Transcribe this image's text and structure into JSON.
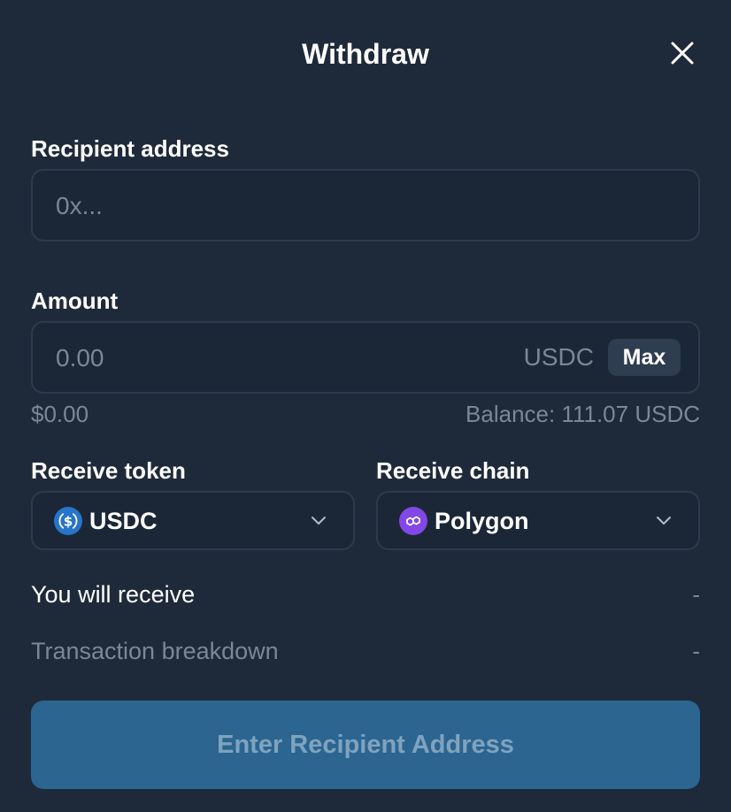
{
  "modal": {
    "title": "Withdraw"
  },
  "recipient": {
    "label": "Recipient address",
    "placeholder": "0x...",
    "value": ""
  },
  "amount": {
    "label": "Amount",
    "placeholder": "0.00",
    "value": "",
    "currency": "USDC",
    "max_label": "Max",
    "usd_value": "$0.00",
    "balance": "Balance: 111.07 USDC"
  },
  "receive_token": {
    "label": "Receive token",
    "selected": "USDC",
    "icon": "usdc-icon",
    "icon_color": "#2775ca"
  },
  "receive_chain": {
    "label": "Receive chain",
    "selected": "Polygon",
    "icon": "polygon-icon",
    "icon_color": "#8247e5"
  },
  "summary": {
    "receive_label": "You will receive",
    "receive_value": "-",
    "breakdown_label": "Transaction breakdown",
    "breakdown_value": "-"
  },
  "submit": {
    "label": "Enter Recipient Address",
    "disabled": true
  },
  "colors": {
    "background": "#1e2a3a",
    "field_border": "#2c3a4b",
    "muted_text": "#7c8795",
    "button_bg": "#2b6590",
    "button_text": "#7fa3bf"
  }
}
